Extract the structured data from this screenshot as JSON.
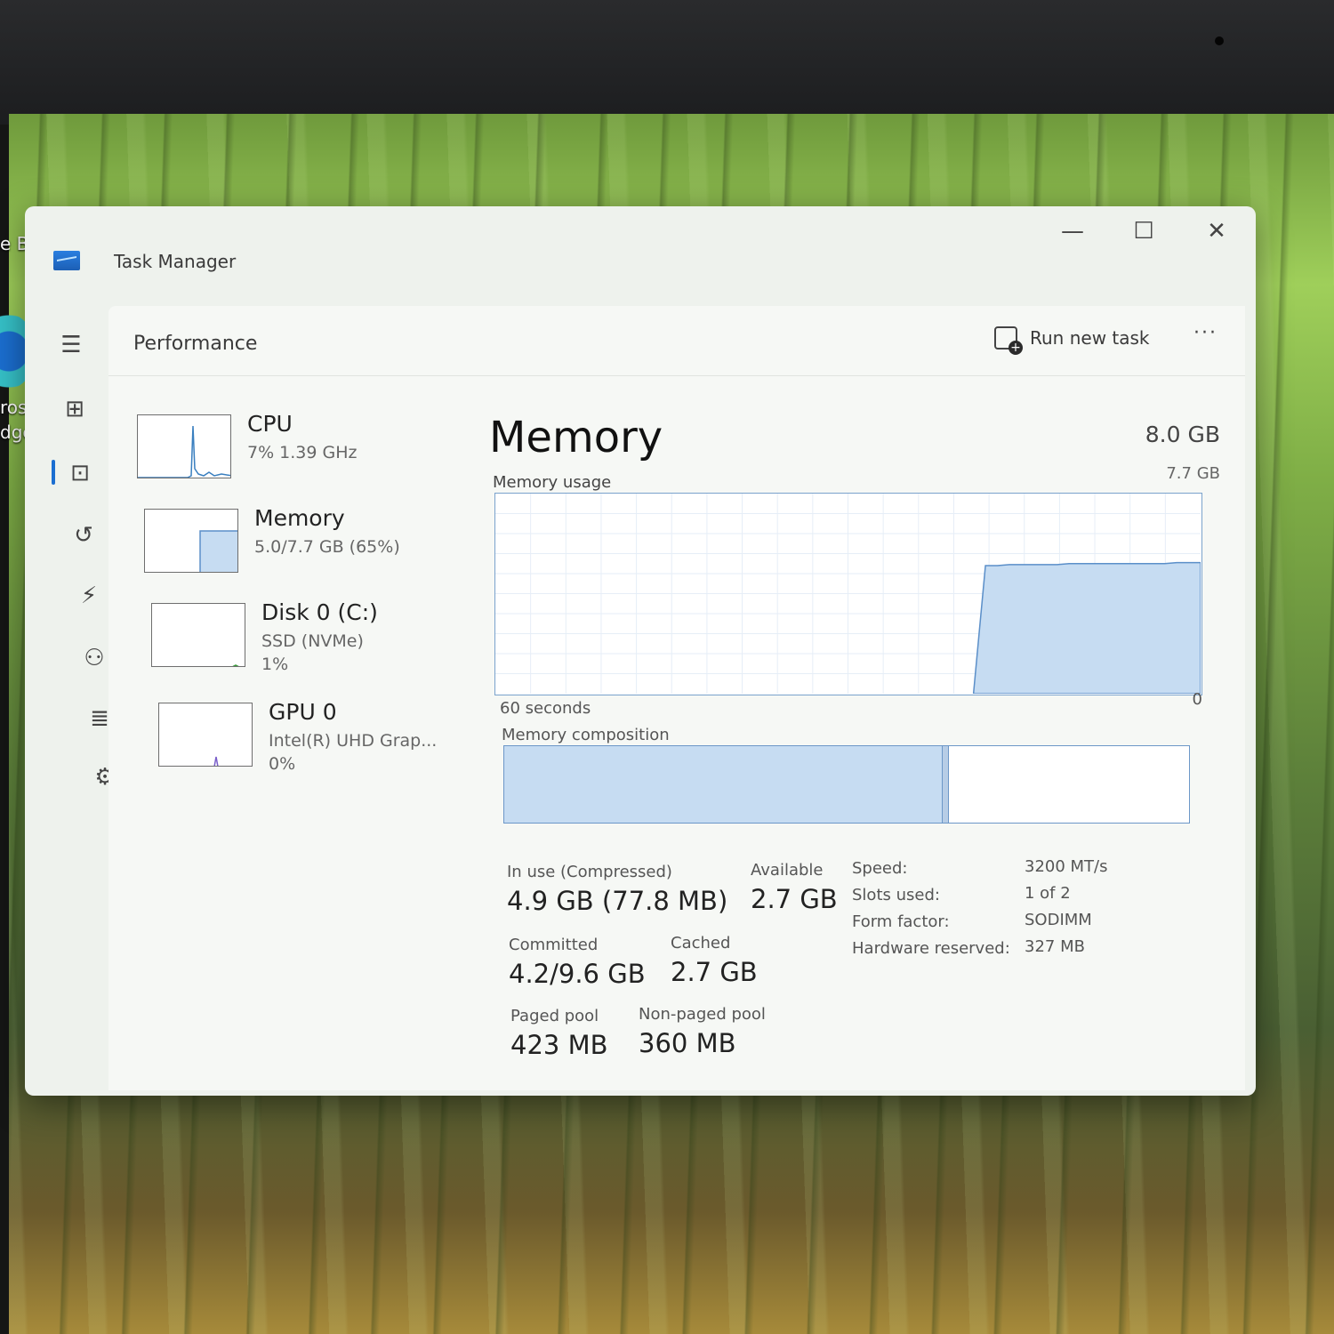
{
  "desktop": {
    "icon_label_line1": "rosof",
    "icon_label_line2": "dge",
    "edge_fragment": "e B"
  },
  "window": {
    "title": "Task Manager",
    "minimize_glyph": "—",
    "maximize_glyph": "☐",
    "close_glyph": "✕"
  },
  "header": {
    "title": "Performance",
    "run_task_label": "Run new task",
    "more_glyph": "···"
  },
  "nav": {
    "items": [
      {
        "name": "hamburger-icon",
        "glyph": "☰"
      },
      {
        "name": "processes-icon",
        "glyph": "⊞"
      },
      {
        "name": "performance-icon",
        "glyph": "⊡"
      },
      {
        "name": "app-history-icon",
        "glyph": "↺"
      },
      {
        "name": "startup-apps-icon",
        "glyph": "⚡"
      },
      {
        "name": "users-icon",
        "glyph": "⚇"
      },
      {
        "name": "details-icon",
        "glyph": "≣"
      },
      {
        "name": "services-icon",
        "glyph": "⚙"
      }
    ],
    "settings_glyph": "⚙"
  },
  "devices": [
    {
      "name": "CPU",
      "sub1": "7%  1.39 GHz",
      "sub2": ""
    },
    {
      "name": "Memory",
      "sub1": "5.0/7.7 GB (65%)",
      "sub2": ""
    },
    {
      "name": "Disk 0 (C:)",
      "sub1": "SSD (NVMe)",
      "sub2": "1%"
    },
    {
      "name": "GPU 0",
      "sub1": "Intel(R) UHD Grap...",
      "sub2": "0%"
    }
  ],
  "memory": {
    "title": "Memory",
    "total": "8.0 GB",
    "usage_label": "Memory usage",
    "usage_max": "7.7 GB",
    "time_left": "60 seconds",
    "time_right": "0",
    "composition_label": "Memory composition",
    "composition": {
      "in_use_fraction": 0.64,
      "modified_fraction": 0.01
    },
    "usage_series_fraction": [
      0,
      0,
      0,
      0,
      0,
      0,
      0,
      0,
      0,
      0,
      0,
      0,
      0,
      0,
      0,
      0,
      0,
      0,
      0,
      0,
      0,
      0,
      0,
      0,
      0,
      0,
      0,
      0,
      0,
      0,
      0,
      0,
      0,
      0,
      0,
      0,
      0,
      0,
      0,
      0,
      0,
      0.64,
      0.64,
      0.645,
      0.645,
      0.645,
      0.645,
      0.645,
      0.65,
      0.65,
      0.65,
      0.65,
      0.65,
      0.65,
      0.65,
      0.65,
      0.65,
      0.655,
      0.655,
      0.655
    ],
    "stats": {
      "in_use_label": "In use (Compressed)",
      "in_use_value": "4.9 GB (77.8 MB)",
      "available_label": "Available",
      "available_value": "2.7 GB",
      "committed_label": "Committed",
      "committed_value": "4.2/9.6 GB",
      "cached_label": "Cached",
      "cached_value": "2.7 GB",
      "paged_label": "Paged pool",
      "paged_value": "423 MB",
      "nonpaged_label": "Non-paged pool",
      "nonpaged_value": "360 MB"
    },
    "specs": [
      {
        "label": "Speed:",
        "value": "3200 MT/s"
      },
      {
        "label": "Slots used:",
        "value": "1 of 2"
      },
      {
        "label": "Form factor:",
        "value": "SODIMM"
      },
      {
        "label": "Hardware reserved:",
        "value": "327 MB"
      }
    ]
  },
  "colors": {
    "accent": "#1b6fd1",
    "chart_fill": "#c6dcf2",
    "chart_line": "#5b8fc9",
    "cpu_line": "#3a7fbf"
  }
}
